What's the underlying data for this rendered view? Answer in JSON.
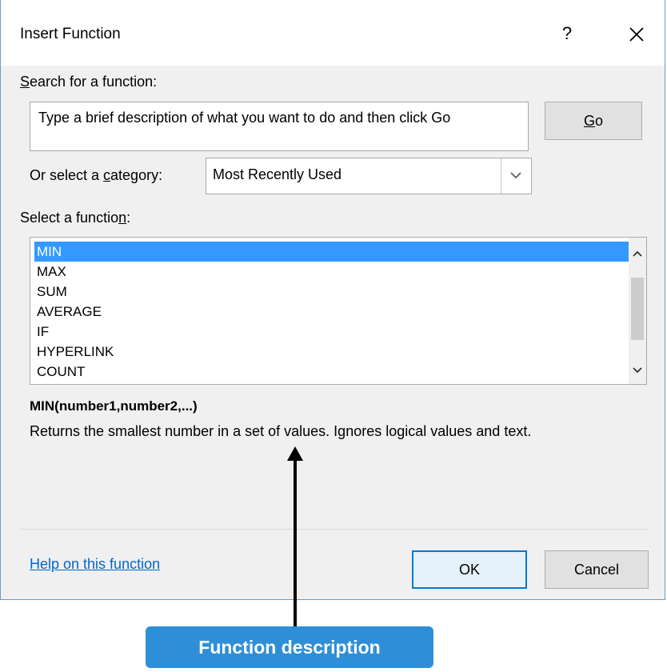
{
  "dialog": {
    "title": "Insert Function",
    "help_button": "?",
    "search": {
      "label_prefix": "",
      "label_ul": "S",
      "label_rest": "earch for a function:",
      "placeholder": "Type a brief description of what you want to do and then click Go",
      "go_prefix": "",
      "go_ul": "G",
      "go_rest": "o"
    },
    "category": {
      "label_pre": "Or select a ",
      "label_ul": "c",
      "label_post": "ategory:",
      "value": "Most Recently Used"
    },
    "function_list": {
      "label_pre": "Select a functio",
      "label_ul": "n",
      "label_post": ":",
      "items": [
        "MIN",
        "MAX",
        "SUM",
        "AVERAGE",
        "IF",
        "HYPERLINK",
        "COUNT"
      ],
      "selected_index": 0
    },
    "syntax": "MIN(number1,number2,...)",
    "description": "Returns the smallest number in a set of values. Ignores logical values and text.",
    "help_link": "Help on this function",
    "ok_label": "OK",
    "cancel_label": "Cancel"
  },
  "annotation": {
    "callout_label": "Function description"
  },
  "colors": {
    "selection": "#3399ff",
    "link": "#0066cc",
    "callout": "#2e8fd8",
    "focus_border": "#0078d7"
  },
  "icons": {
    "close": "close-icon",
    "dropdown": "chevron-down-icon",
    "scroll_up": "chevron-up-icon",
    "scroll_down": "chevron-down-icon"
  }
}
